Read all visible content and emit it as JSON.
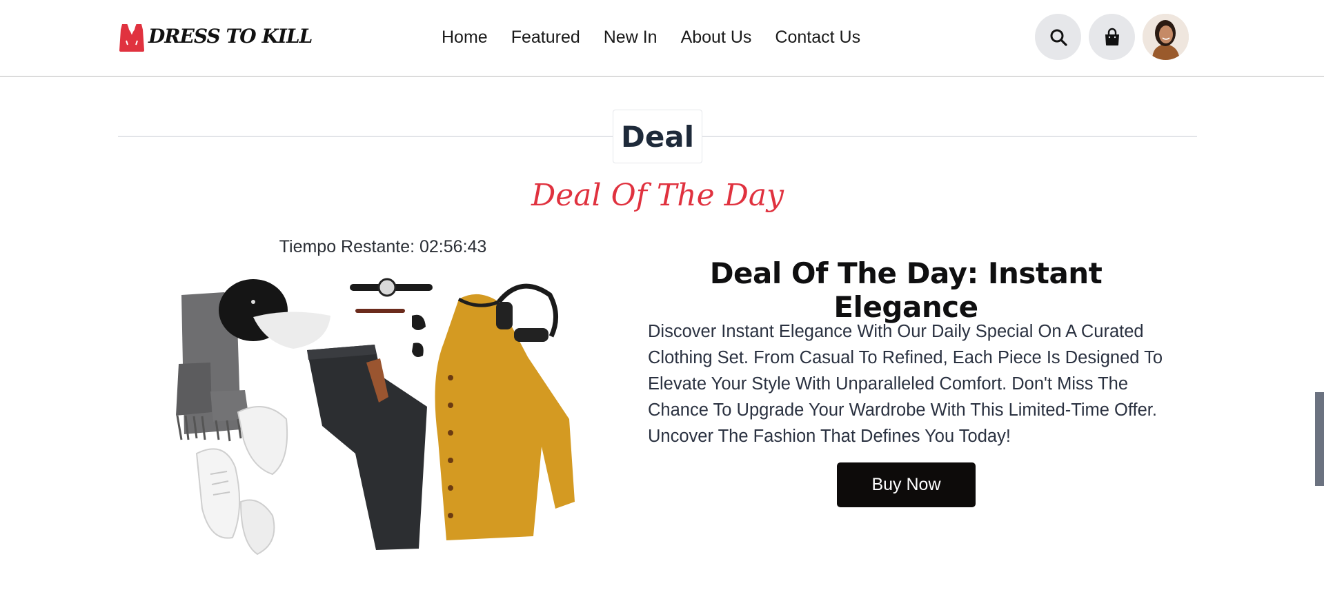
{
  "brand": {
    "name": "DRESS TO KILL",
    "logo_color": "#e0323f"
  },
  "nav": {
    "items": [
      "Home",
      "Featured",
      "New In",
      "About Us",
      "Contact Us"
    ]
  },
  "header_icons": {
    "search": "search-icon",
    "cart": "shopping-bag-icon",
    "avatar": "user-avatar"
  },
  "section": {
    "title": "Deal",
    "subtitle": "Deal Of The Day"
  },
  "deal": {
    "timer_text": "Tiempo Restante: 02:56:43",
    "title": "Deal Of The Day: Instant Elegance",
    "description": "Discover Instant Elegance With Our Daily Special On A Curated Clothing Set. From Casual To Refined, Each Piece Is Designed To Elevate Your Style With Unparalleled Comfort. Don't Miss The Chance To Upgrade Your Wardrobe With This Limited-Time Offer. Uncover The Fashion That Defines You Today!",
    "button_label": "Buy Now"
  },
  "colors": {
    "accent": "#e0323f",
    "button_bg": "#0d0b0a",
    "icon_bg": "#e6e7ea"
  }
}
